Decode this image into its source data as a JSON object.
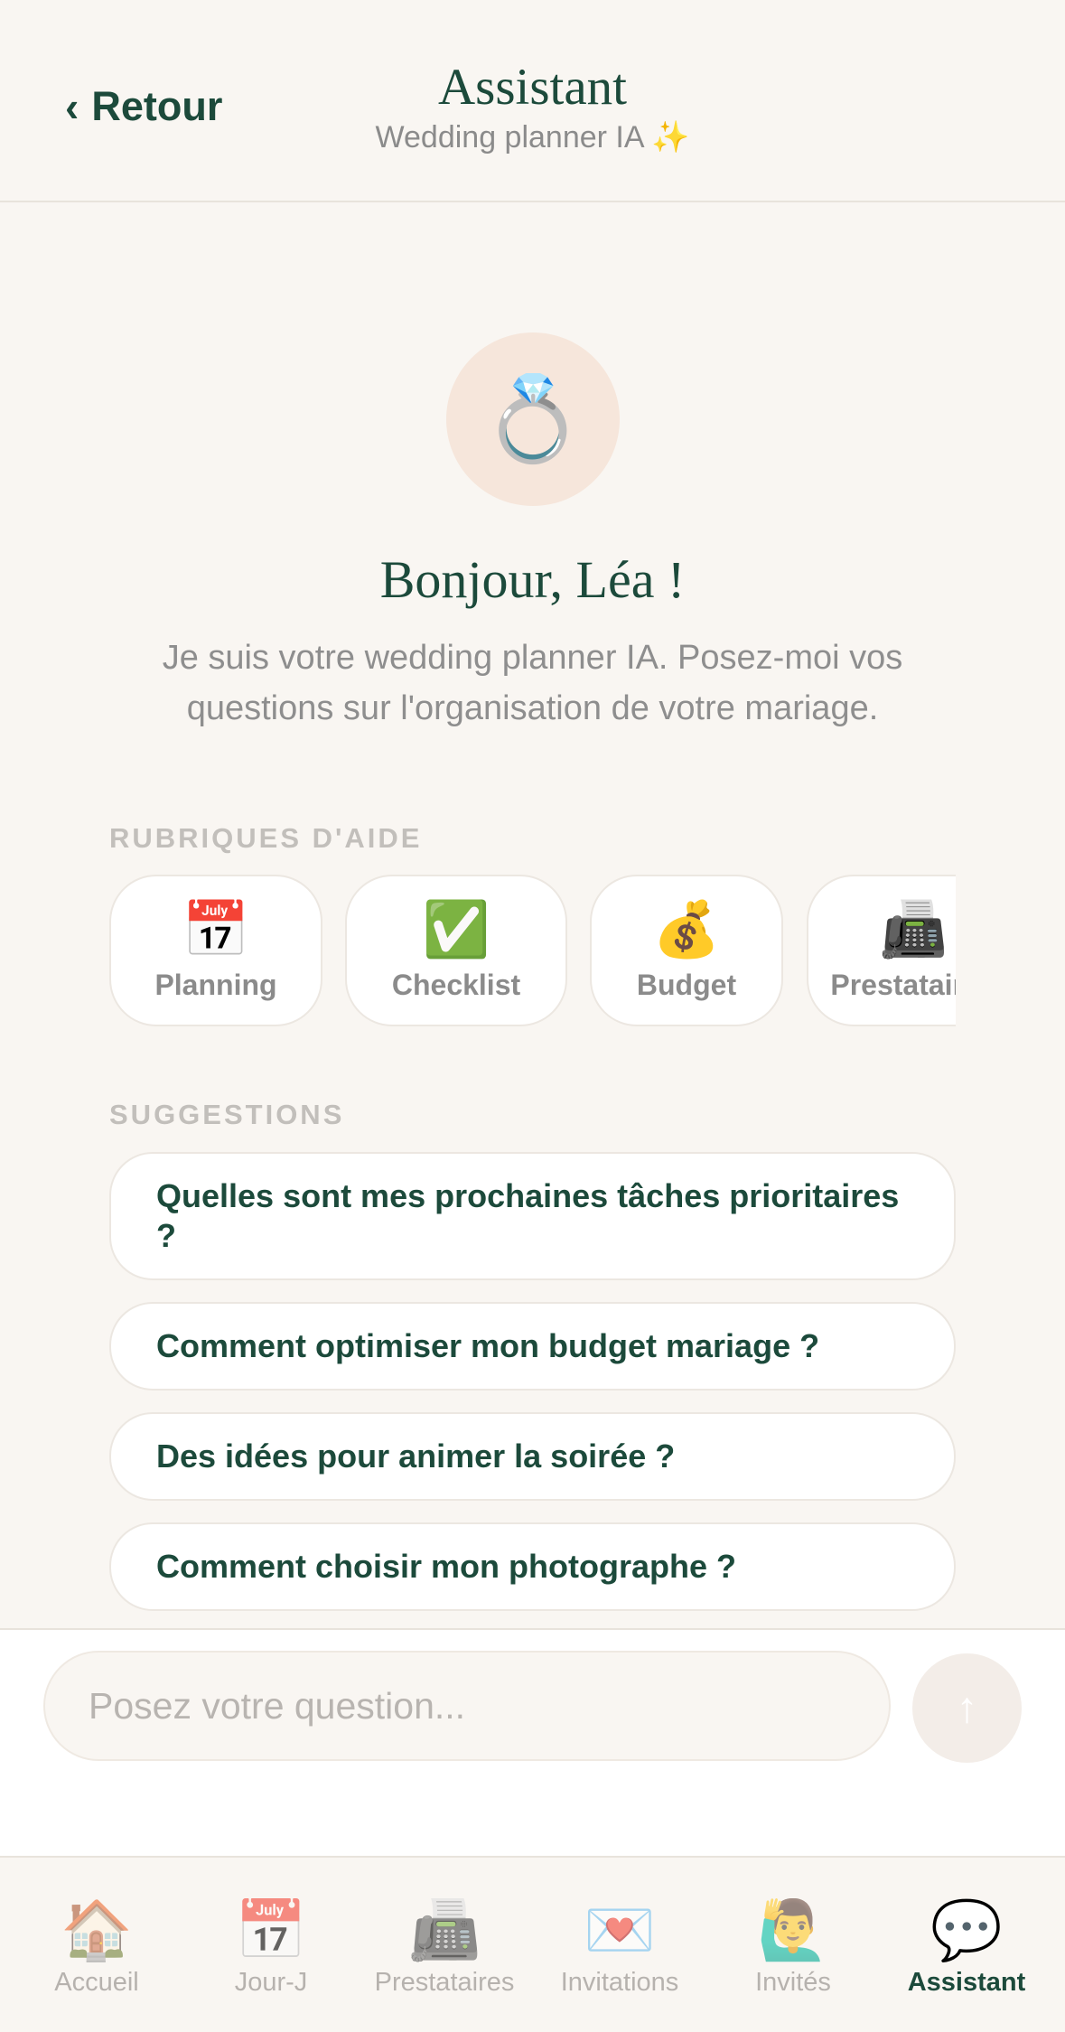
{
  "header": {
    "back_label": "Retour",
    "title": "Assistant",
    "subtitle": "Wedding planner IA ✨"
  },
  "hero": {
    "avatar_icon": "💍",
    "greeting": "Bonjour, Léa !",
    "intro": "Je suis votre wedding planner IA. Posez-moi vos questions sur l'organisation de votre mariage."
  },
  "categories": {
    "label": "RUBRIQUES D'AIDE",
    "items": [
      {
        "icon": "📅",
        "label": "Planning"
      },
      {
        "icon": "✅",
        "label": "Checklist"
      },
      {
        "icon": "💰",
        "label": "Budget"
      },
      {
        "icon": "📠",
        "label": "Prestataires"
      }
    ]
  },
  "suggestions": {
    "label": "SUGGESTIONS",
    "items": [
      "Quelles sont mes prochaines tâches prioritaires ?",
      "Comment optimiser mon budget mariage ?",
      "Des idées pour animer la soirée ?",
      "Comment choisir mon photographe ?"
    ]
  },
  "composer": {
    "placeholder": "Posez votre question...",
    "send_icon": "arrow-up-icon"
  },
  "tabbar": {
    "items": [
      {
        "icon": "🏠",
        "label": "Accueil"
      },
      {
        "icon": "📅",
        "label": "Jour-J"
      },
      {
        "icon": "📠",
        "label": "Prestataires"
      },
      {
        "icon": "💌",
        "label": "Invitations"
      },
      {
        "icon": "🙋‍♂️",
        "label": "Invités"
      },
      {
        "icon": "💬",
        "label": "Assistant"
      }
    ],
    "active": "Assistant"
  },
  "colors": {
    "brand": "#1c4a3b",
    "background": "#f9f6f2",
    "muted": "#8b8b8b"
  }
}
